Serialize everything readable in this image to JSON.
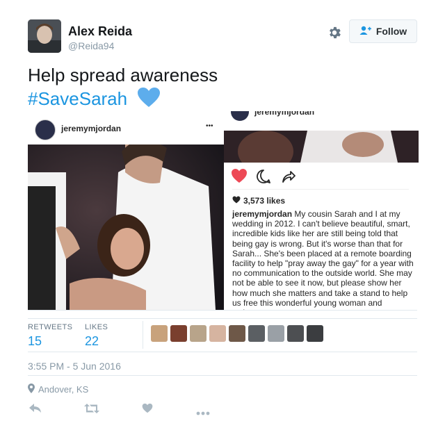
{
  "user": {
    "name": "Alex Reida",
    "handle": "@Reida94"
  },
  "follow_label": "Follow",
  "tweet": {
    "line1": "Help spread awareness",
    "hashtag": "#SaveSarah"
  },
  "embedded_left": {
    "username": "jeremymjordan",
    "more": "•••"
  },
  "embedded_right": {
    "username_partial": "jeremymjordan",
    "likes": "3,573 likes",
    "caption_user": "jeremymjordan",
    "caption": "My cousin Sarah and I at my wedding in 2012. I can't believe beautiful, smart, incredible kids like her are still being told that being gay is wrong. But it's worse than that for Sarah... She's been placed at a remote boarding facility to help \"pray away the gay\" for a year with no communication to the outside world. She may not be able to see it now, but please show her how much she matters and take a stand to help us free this wonderful young woman and welcome"
  },
  "stats": {
    "retweets_label": "RETWEETS",
    "retweets_value": "15",
    "likes_label": "LIKES",
    "likes_value": "22"
  },
  "timestamp": "3:55 PM - 5 Jun 2016",
  "location": "Andover, KS",
  "colors": {
    "accent": "#1b95e0",
    "heart": "#e0245e",
    "muted": "#8899a6"
  }
}
